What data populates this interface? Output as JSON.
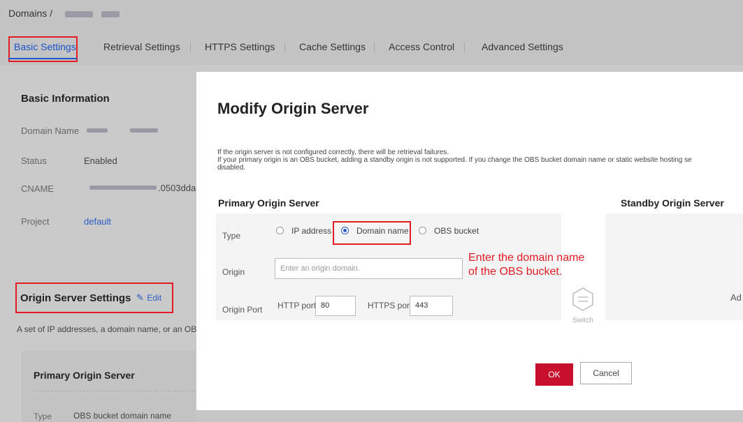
{
  "breadcrumb": {
    "root": "Domains /"
  },
  "tabs": [
    {
      "label": "Basic Settings",
      "active": true
    },
    {
      "label": "Retrieval Settings"
    },
    {
      "label": "HTTPS Settings"
    },
    {
      "label": "Cache Settings"
    },
    {
      "label": "Access Control"
    },
    {
      "label": "Advanced Settings"
    }
  ],
  "basic_info": {
    "title": "Basic Information",
    "rows": [
      {
        "label": "Domain Name",
        "value": ""
      },
      {
        "label": "Status",
        "value": "Enabled"
      },
      {
        "label": "CNAME",
        "value": ".0503dda"
      },
      {
        "label": "Project",
        "value": "default"
      }
    ]
  },
  "origin_settings": {
    "title": "Origin Server Settings",
    "edit_label": "Edit",
    "description": "A set of IP addresses, a domain name, or an OBS",
    "primary_title": "Primary Origin Server",
    "type_label": "Type",
    "type_value": "OBS bucket domain name"
  },
  "modal": {
    "title": "Modify Origin Server",
    "note_line1": "If the origin server is not configured correctly, there will be retrieval failures.",
    "note_line2": "If your primary origin is an OBS bucket, adding a standby origin is not supported. If you change the OBS bucket domain name or static website hosting se",
    "note_line3": "disabled.",
    "primary_title": "Primary Origin Server",
    "standby_title": "Standby Origin Server",
    "type_label": "Type",
    "type_options": [
      "IP address",
      "Domain name",
      "OBS bucket"
    ],
    "type_selected": "Domain name",
    "origin_label": "Origin",
    "origin_placeholder": "Enter an origin domain.",
    "port_label": "Origin Port",
    "http_port_label": "HTTP port",
    "http_port_value": "80",
    "https_port_label": "HTTPS port",
    "https_port_value": "443",
    "switch_label": "Switch",
    "standby_truncated": "Ad",
    "annotation_line1": "Enter the domain name",
    "annotation_line2": "of the OBS bucket.",
    "ok_label": "OK",
    "cancel_label": "Cancel"
  },
  "colors": {
    "accent": "#2c5cc5",
    "highlight": "#e31b23",
    "primary_button": "#c8102e"
  }
}
